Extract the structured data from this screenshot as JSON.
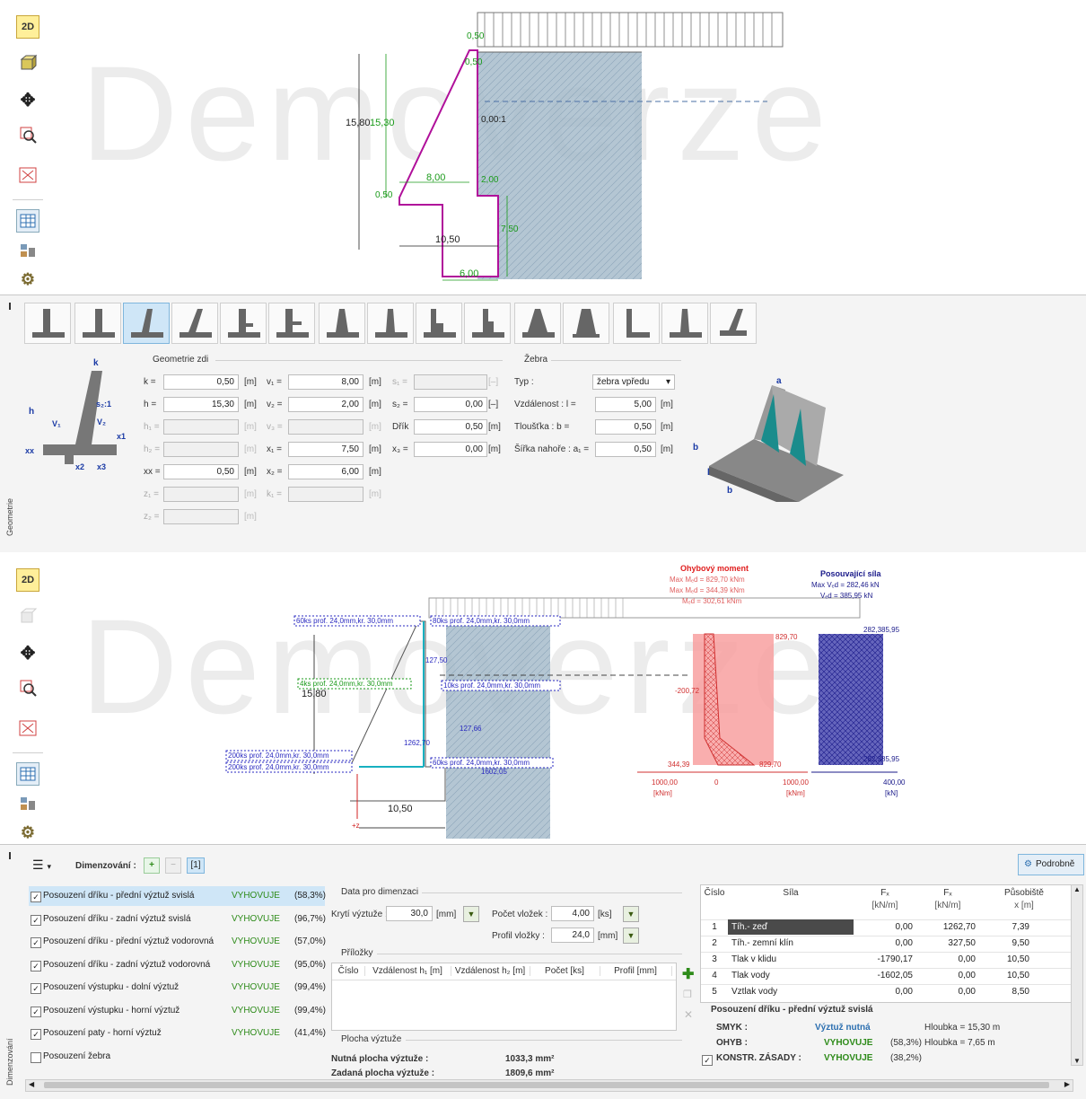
{
  "watermark": "Demoverze",
  "toolbar_top": {
    "btn_2d": "2D",
    "btn_3d": "3D"
  },
  "toolbar_bottom": {
    "btn_2d": "2D",
    "btn_3d": "3D"
  },
  "drawing1": {
    "dims": [
      "0,50",
      "0,50",
      "15,80",
      "15,30",
      "0,00:1",
      "8,00",
      "2,00",
      "0,50",
      "7,50",
      "10,50",
      "6,00"
    ]
  },
  "geometry": {
    "side_label": "Geometrie",
    "group_wall": "Geometrie zdi",
    "group_ribs": "Žebra",
    "rows_left": [
      {
        "label": "k =",
        "value": "0,50",
        "unit": "[m]",
        "enabled": true
      },
      {
        "label": "h =",
        "value": "15,30",
        "unit": "[m]",
        "enabled": true
      },
      {
        "label": "h₁ =",
        "value": "",
        "unit": "[m]",
        "enabled": false
      },
      {
        "label": "h₂ =",
        "value": "",
        "unit": "[m]",
        "enabled": false
      },
      {
        "label": "xx =",
        "value": "0,50",
        "unit": "[m]",
        "enabled": true
      },
      {
        "label": "z₁ =",
        "value": "",
        "unit": "[m]",
        "enabled": false
      },
      {
        "label": "z₂ =",
        "value": "",
        "unit": "[m]",
        "enabled": false
      }
    ],
    "rows_mid": [
      {
        "label": "v₁ =",
        "value": "8,00",
        "unit": "[m]",
        "enabled": true
      },
      {
        "label": "v₂ =",
        "value": "2,00",
        "unit": "[m]",
        "enabled": true
      },
      {
        "label": "v₃ =",
        "value": "",
        "unit": "[m]",
        "enabled": false
      },
      {
        "label": "x₁ =",
        "value": "7,50",
        "unit": "[m]",
        "enabled": true
      },
      {
        "label": "x₂ =",
        "value": "6,00",
        "unit": "[m]",
        "enabled": true
      },
      {
        "label": "k₁ =",
        "value": "",
        "unit": "[m]",
        "enabled": false
      }
    ],
    "rows_right": [
      {
        "label": "s₁ =",
        "value": "",
        "unit": "[–]",
        "enabled": false
      },
      {
        "label": "s₂ =",
        "value": "0,00",
        "unit": "[–]",
        "enabled": true
      },
      {
        "label": "Dřík",
        "value": "0,50",
        "unit": "[m]",
        "enabled": true
      },
      {
        "label": "x₃ =",
        "value": "0,00",
        "unit": "[m]",
        "enabled": true
      }
    ],
    "ribs": {
      "type_label": "Typ :",
      "type_value": "žebra vpředu",
      "dist_label": "Vzdálenost : l =",
      "dist_value": "5,00",
      "dist_unit": "[m]",
      "thick_label": "Tloušťka : b =",
      "thick_value": "0,50",
      "thick_unit": "[m]",
      "width_label": "Šířka nahoře : a₁ =",
      "width_value": "0,50",
      "width_unit": "[m]"
    },
    "sketch_labels": {
      "k": "k",
      "h": "h",
      "v1": "V₁",
      "v2": "V₂",
      "s": "s₂:1",
      "x1": "x1",
      "xx": "xx",
      "x2": "x2",
      "x3": "x3"
    }
  },
  "drawing2": {
    "labels": [
      "60ks prof. 24,0mm,kr. 30,0mm",
      "80ks prof. 24,0mm,kr. 30,0mm",
      "4ks prof. 24,0mm,kr. 30,0mm",
      "10ks prof. 24,0mm,kr. 30,0mm",
      "200ks prof. 24,0mm,kr. 30,0mm",
      "200ks prof. 24,0mm,kr. 30,0mm",
      "60ks prof. 24,0mm,kr. 30,0mm"
    ],
    "dims": {
      "h": "15,80",
      "w": "10,50",
      "a": "127,50",
      "b": "127,66",
      "c": "1262,70",
      "d": "1602,05",
      "z": "+z"
    },
    "moment": {
      "title": "Ohybový moment",
      "l1": "Max Mₑd = 829,70 kNm",
      "l2": "Max Mₑd = 344,39 kNm",
      "l3": "Mₑd = 302,61 kNm",
      "v1": "829,70",
      "v2": "-200,72",
      "v3": "344,39",
      "v4": "829,70",
      "axis_l": "1000,00",
      "axis_r": "1000,00",
      "unit": "[kNm]",
      "zero": "0"
    },
    "shear": {
      "title": "Posouvající síla",
      "l1": "Max Vₑd = 282,46 kN",
      "l2": "Vₑd = 385,95 kN",
      "v1": "282,385,95",
      "v2": "282,385,95",
      "axis_r": "400,00",
      "unit": "[kN]"
    }
  },
  "dimensioning": {
    "side_label": "Dimenzování",
    "header_label": "Dimenzování :",
    "header_index": "[1]",
    "detail_button": "Podrobně",
    "checks": [
      {
        "label": "Posouzení dříku - přední výztuž svislá",
        "result": "VYHOVUJE",
        "pct": "(58,3%)",
        "checked": true,
        "selected": true
      },
      {
        "label": "Posouzení dříku - zadní výztuž svislá",
        "result": "VYHOVUJE",
        "pct": "(96,7%)",
        "checked": true,
        "selected": false
      },
      {
        "label": "Posouzení dříku - přední výztuž vodorovná",
        "result": "VYHOVUJE",
        "pct": "(57,0%)",
        "checked": true,
        "selected": false
      },
      {
        "label": "Posouzení dříku - zadní výztuž vodorovná",
        "result": "VYHOVUJE",
        "pct": "(95,0%)",
        "checked": true,
        "selected": false
      },
      {
        "label": "Posouzení výstupku - dolní výztuž",
        "result": "VYHOVUJE",
        "pct": "(99,4%)",
        "checked": true,
        "selected": false
      },
      {
        "label": "Posouzení výstupku - horní výztuž",
        "result": "VYHOVUJE",
        "pct": "(99,4%)",
        "checked": true,
        "selected": false
      },
      {
        "label": "Posouzení paty - horní výztuž",
        "result": "VYHOVUJE",
        "pct": "(41,4%)",
        "checked": true,
        "selected": false
      },
      {
        "label": "Posouzení žebra",
        "result": "",
        "pct": "",
        "checked": false,
        "selected": false
      }
    ],
    "data_group": "Data pro dimenzaci",
    "cover_label": "Krytí výztuže :",
    "cover_value": "30,0",
    "cover_unit": "[mm]",
    "count_label": "Počet vložek :",
    "count_value": "4,00",
    "count_unit": "[ks]",
    "profile_label": "Profil vložky :",
    "profile_value": "24,0",
    "profile_unit": "[mm]",
    "attach_group": "Příložky",
    "attach_cols": [
      "Číslo",
      "Vzdálenost h₁ [m]",
      "Vzdálenost h₂ [m]",
      "Počet [ks]",
      "Profil [mm]"
    ],
    "area_group": "Plocha výztuže",
    "req_label": "Nutná plocha výztuže :",
    "req_value": "1033,3 mm²",
    "given_label": "Zadaná plocha výztuže :",
    "given_value": "1809,6 mm²",
    "forces_cols": [
      "Číslo",
      "Síla",
      "Fₓ",
      "Fₓ",
      "Působiště"
    ],
    "forces_units": [
      "",
      "",
      "[kN/m]",
      "[kN/m]",
      "x [m]"
    ],
    "forces": [
      {
        "n": "1",
        "name": "Tíh.- zeď",
        "fx": "0,00",
        "fz": "1262,70",
        "x": "7,39"
      },
      {
        "n": "2",
        "name": "Tíh.- zemní klín",
        "fx": "0,00",
        "fz": "327,50",
        "x": "9,50"
      },
      {
        "n": "3",
        "name": "Tlak v klidu",
        "fx": "-1790,17",
        "fz": "0,00",
        "x": "10,50"
      },
      {
        "n": "4",
        "name": "Tlak vody",
        "fx": "-1602,05",
        "fz": "0,00",
        "x": "10,50"
      },
      {
        "n": "5",
        "name": "Vztlak vody",
        "fx": "0,00",
        "fz": "0,00",
        "x": "8,50"
      }
    ],
    "result_title": "Posouzení dříku - přední výztuž svislá",
    "shear_label": "SMYK :",
    "shear_value": "Výztuž nutná",
    "shear_depth": "Hloubka = 15,30 m",
    "bend_label": "OHYB :",
    "bend_value": "VYHOVUJE",
    "bend_pct": "(58,3%)",
    "bend_depth": "Hloubka = 7,65 m",
    "konstr_label": "KONSTR. ZÁSADY :",
    "konstr_value": "VYHOVUJE",
    "konstr_pct": "(38,2%)"
  }
}
